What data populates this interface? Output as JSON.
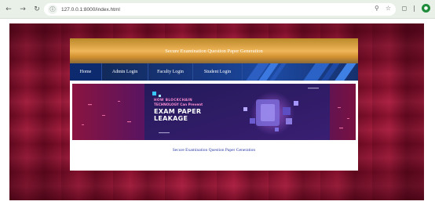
{
  "browser": {
    "url": "127.0.0.1:8000/index.html",
    "nav_back_icon": "arrow-left-icon",
    "nav_forward_icon": "arrow-right-icon",
    "reload_icon": "reload-icon"
  },
  "page": {
    "header_title": "Secure Examination Question Paper Generation",
    "nav": {
      "home": "Home",
      "admin": "Admin Login",
      "faculty": "Faculty Login",
      "student": "Student Login"
    },
    "banner": {
      "line1": "HOW BLOCKCHAIN",
      "line2": "TECHNOLOGY Can Prevent",
      "line3": "EXAM PAPER",
      "line4": "LEAKAGE"
    },
    "caption": "Secure Examination Question Paper Generation"
  },
  "colors": {
    "page_background": "#9a1232",
    "header_gold": "#e0a64a",
    "nav_blue": "#17357a",
    "caption_blue": "#2a3aa8",
    "banner_purple": "#3a1a6e"
  }
}
